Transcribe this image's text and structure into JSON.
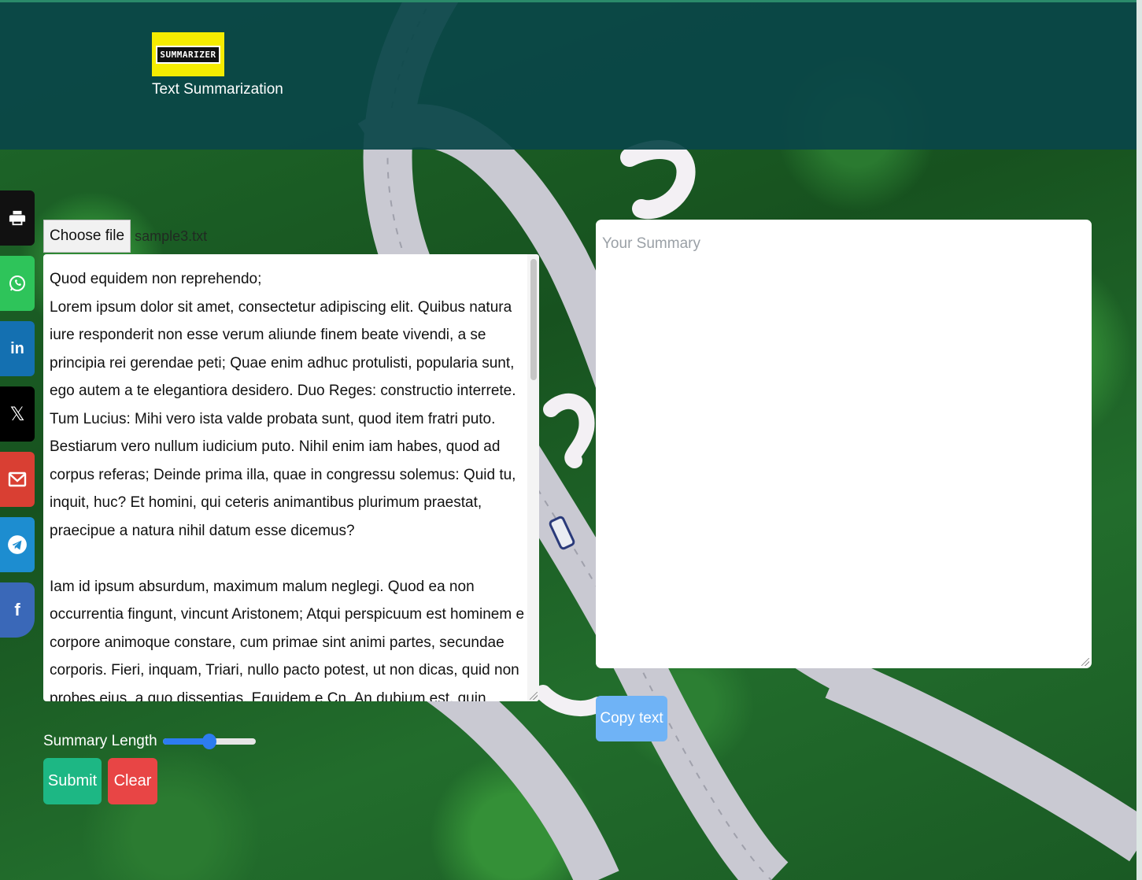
{
  "header": {
    "logo_text": "SUMMARIZER",
    "subtitle": "Text Summarization"
  },
  "share": [
    {
      "name": "print",
      "color": "#111111"
    },
    {
      "name": "whatsapp",
      "color": "#2ec45a"
    },
    {
      "name": "linkedin",
      "color": "#1470b1"
    },
    {
      "name": "x",
      "color": "#000000"
    },
    {
      "name": "gmail",
      "color": "#d93f33"
    },
    {
      "name": "telegram",
      "color": "#1d8dd0"
    },
    {
      "name": "facebook",
      "color": "#3a68b8"
    }
  ],
  "file_input": {
    "button_label": "Choose file",
    "file_name": "sample3.txt"
  },
  "source": {
    "text": "Quod equidem non reprehendo;\nLorem ipsum dolor sit amet, consectetur adipiscing elit. Quibus natura iure responderit non esse verum aliunde finem beate vivendi, a se principia rei gerendae peti; Quae enim adhuc protulisti, popularia sunt, ego autem a te elegantiora desidero. Duo Reges: constructio interrete. Tum Lucius: Mihi vero ista valde probata sunt, quod item fratri puto. Bestiarum vero nullum iudicium puto. Nihil enim iam habes, quod ad corpus referas; Deinde prima illa, quae in congressu solemus: Quid tu, inquit, huc? Et homini, qui ceteris animantibus plurimum praestat, praecipue a natura nihil datum esse dicemus?\n\nIam id ipsum absurdum, maximum malum neglegi. Quod ea non occurrentia fingunt, vincunt Aristonem; Atqui perspicuum est hominem e corpore animoque constare, cum primae sint animi partes, secundae corporis. Fieri, inquam, Triari, nullo pacto potest, ut non dicas, quid non probes eius, a quo dissentias. Equidem e Cn. An dubium est, quin virtus ita maximam partem optineat in rebus humanis, ut reliquas obruat?\n\nQuis istum dolorem timet?"
  },
  "summary": {
    "placeholder": "Your Summary",
    "copy_label": "Copy text"
  },
  "controls": {
    "length_label": "Summary Length",
    "length_value": 0.5,
    "submit_label": "Submit",
    "clear_label": "Clear"
  },
  "colors": {
    "header_bg": "#0a4648",
    "logo_bg": "#f5ec00",
    "submit": "#1db784",
    "clear": "#e84545",
    "copy": "#6fb3f6",
    "slider": "#2d7cf0"
  }
}
